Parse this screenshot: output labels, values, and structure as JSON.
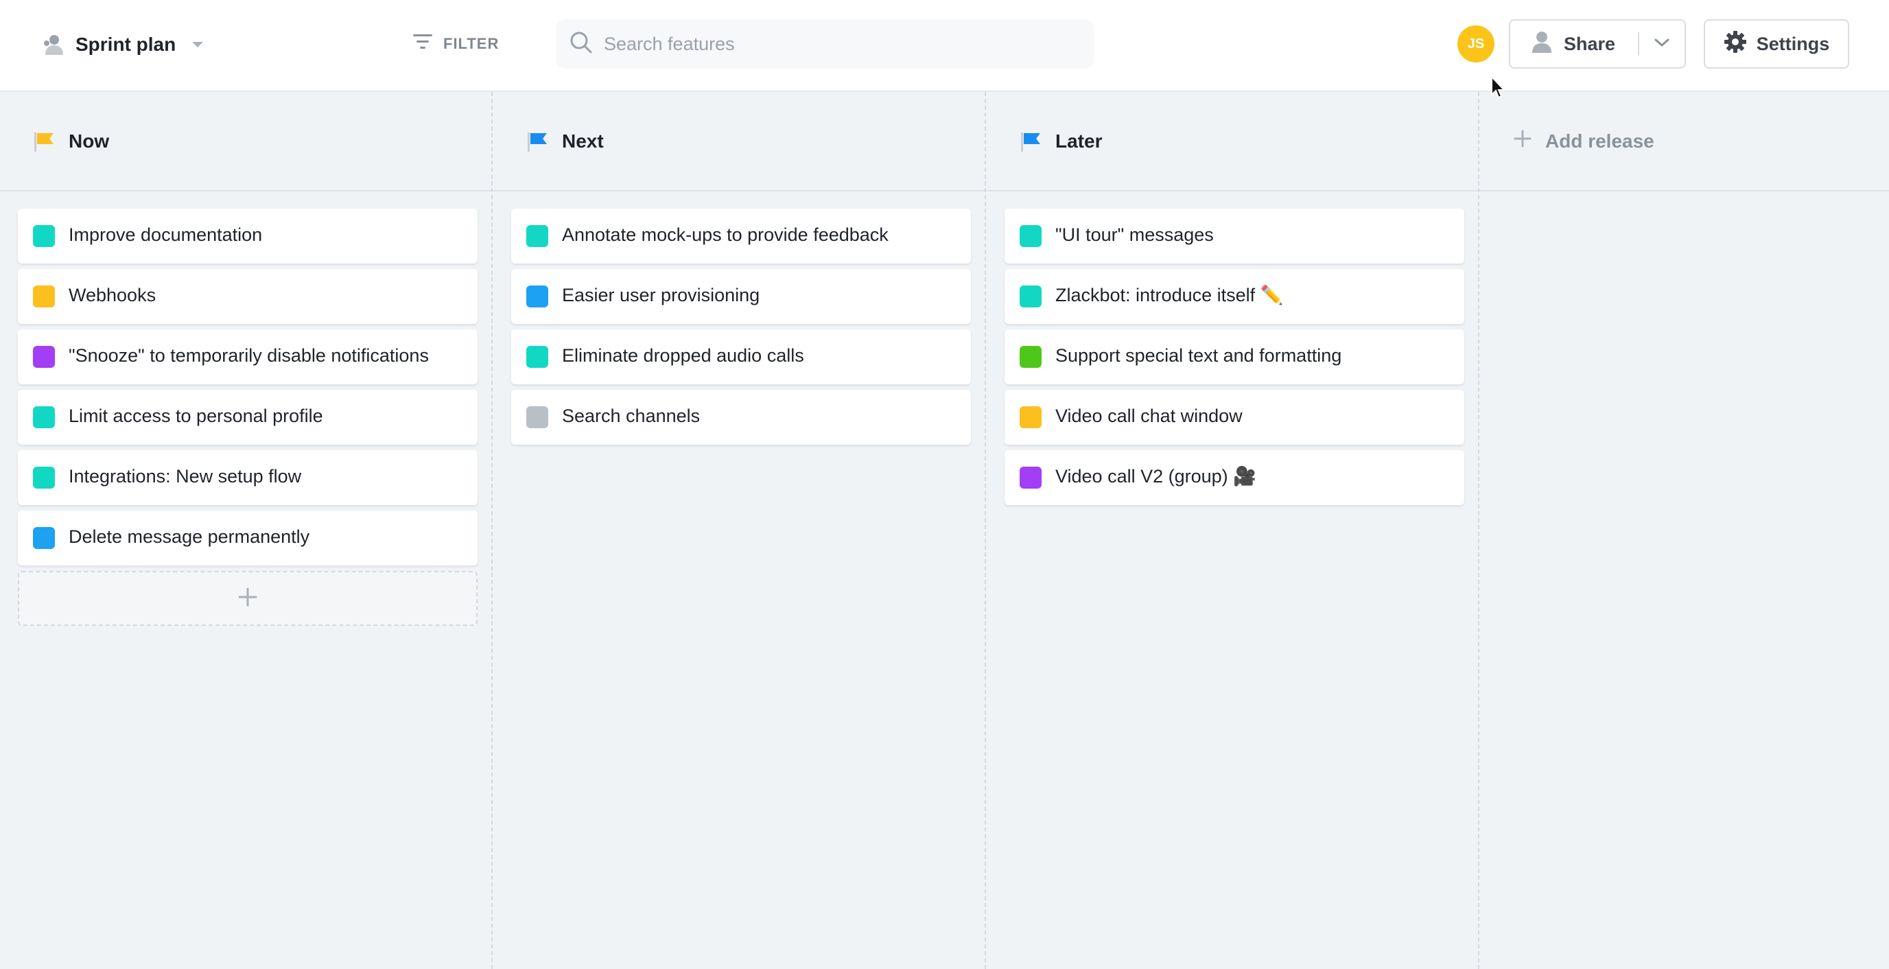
{
  "header": {
    "view_title": "Sprint plan",
    "filter_label": "FILTER",
    "search_placeholder": "Search features",
    "avatar_initials": "JS",
    "share_label": "Share",
    "settings_label": "Settings"
  },
  "colors": {
    "teal": "#12d8c3",
    "amber": "#fcbf1e",
    "purple": "#a23ef4",
    "blue": "#1da1f2",
    "gray": "#b8bfc7",
    "green": "#4fc71a",
    "flag_now": "#fcbf1e",
    "flag_next": "#1a8cf0",
    "flag_later": "#1a8cf0",
    "avatar": "#fcc419"
  },
  "columns": [
    {
      "title": "Now",
      "flag_color": "#fcbf1e",
      "cards": [
        {
          "text": "Improve documentation",
          "color": "#12d8c3"
        },
        {
          "text": "Webhooks",
          "color": "#fcbf1e"
        },
        {
          "text": "\"Snooze\" to temporarily disable notifications",
          "color": "#a23ef4"
        },
        {
          "text": "Limit access to personal profile",
          "color": "#12d8c3"
        },
        {
          "text": "Integrations: New setup flow",
          "color": "#12d8c3"
        },
        {
          "text": "Delete message permanently",
          "color": "#1da1f2"
        }
      ]
    },
    {
      "title": "Next",
      "flag_color": "#1a8cf0",
      "cards": [
        {
          "text": "Annotate mock-ups to provide feedback",
          "color": "#12d8c3"
        },
        {
          "text": "Easier user provisioning",
          "color": "#1da1f2"
        },
        {
          "text": "Eliminate dropped audio calls",
          "color": "#12d8c3"
        },
        {
          "text": "Search channels",
          "color": "#b8bfc7"
        }
      ]
    },
    {
      "title": "Later",
      "flag_color": "#1a8cf0",
      "cards": [
        {
          "text": "\"UI tour\" messages",
          "color": "#12d8c3"
        },
        {
          "text": "Zlackbot: introduce itself ✏️",
          "color": "#12d8c3"
        },
        {
          "text": "Support special text and formatting",
          "color": "#4fc71a"
        },
        {
          "text": "Video call chat window",
          "color": "#fcbf1e"
        },
        {
          "text": "Video call V2 (group) 🎥",
          "color": "#a23ef4"
        }
      ]
    }
  ],
  "add_release_label": "Add release"
}
